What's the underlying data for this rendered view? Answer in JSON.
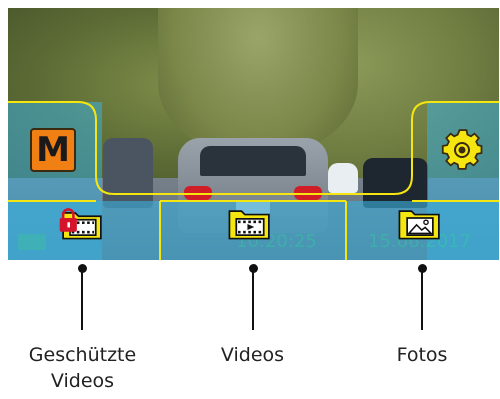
{
  "camera_view": {
    "mode_button": {
      "label": "M"
    },
    "settings_button": {
      "icon": "gear-icon"
    },
    "status": {
      "time": "10:20:25",
      "date": "15.06.2017"
    }
  },
  "menu_items": [
    {
      "icon": "locked-film-folder-icon",
      "label_line1": "Geschützte",
      "label_line2": "Videos"
    },
    {
      "icon": "video-folder-icon",
      "label": "Videos"
    },
    {
      "icon": "photo-folder-icon",
      "label": "Fotos"
    }
  ],
  "colors": {
    "frame_yellow": "#f5e60f",
    "overlay_blue": "#3cafdc",
    "mode_orange": "#f07f14",
    "lock_red": "#d4142a"
  }
}
